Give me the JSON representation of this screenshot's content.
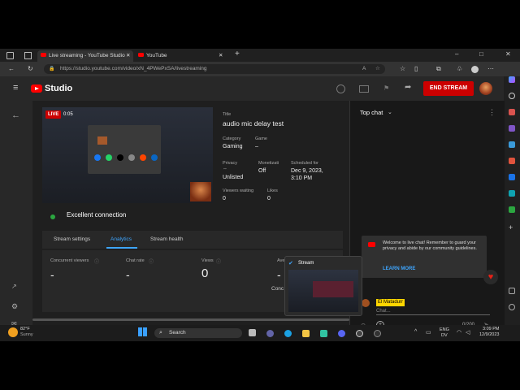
{
  "browser": {
    "tabs": [
      {
        "label": "Live streaming - YouTube Studio",
        "close": "✕"
      },
      {
        "label": "YouTube",
        "close": "✕"
      }
    ],
    "new_tab": "+",
    "url": "https://studio.youtube.com/video/xN_4PWePxSA/livestreaming"
  },
  "studio": {
    "brand": "Studio",
    "end_stream": "END STREAM",
    "preview": {
      "live": "LIVE",
      "time": "0:05"
    },
    "info": {
      "title_label": "Title",
      "title_value": "audio mic delay test",
      "category_label": "Category",
      "category_value": "Gaming",
      "game_label": "Game",
      "game_value": "–",
      "privacy_label": "Privacy",
      "privacy_value": "Unlisted",
      "monetization_label": "Monetizati",
      "monetization_value": "Off",
      "scheduled_label": "Scheduled for",
      "scheduled_value_1": "Dec 9, 2023,",
      "scheduled_value_2": "3:10 PM",
      "viewers_label": "Viewers waiting",
      "viewers_value": "0",
      "likes_label": "Likes",
      "likes_value": "0"
    },
    "connection": "Excellent connection",
    "tabs": [
      {
        "label": "Stream settings"
      },
      {
        "label": "Analytics"
      },
      {
        "label": "Stream health"
      }
    ],
    "analytics": {
      "concurrent_label": "Concurrent viewers",
      "concurrent_value": "-",
      "chat_rate_label": "Chat rate",
      "chat_rate_value": "-",
      "views_label": "Views",
      "views_value": "0",
      "avg_label": "Ave",
      "avg_value": "-",
      "conc_label": "Conc"
    }
  },
  "chat": {
    "title": "Top chat",
    "welcome": "Welcome to live chat! Remember to guard your privacy and abide by our community guidelines.",
    "learn_more": "LEARN MORE",
    "username": "El Matadurr",
    "placeholder": "Chat...",
    "count": "0/200"
  },
  "popup": {
    "title": "Stream"
  },
  "taskbar": {
    "weather_temp": "82°F",
    "weather_desc": "Sunny",
    "search": "Search",
    "lang_1": "ENG",
    "lang_2": "DV",
    "time": "3:09 PM",
    "date": "12/9/2023"
  },
  "colors": {
    "accent": "#3ea6ff",
    "end_stream": "#cc0000",
    "live": "#cc0000",
    "good": "#2ba640"
  }
}
